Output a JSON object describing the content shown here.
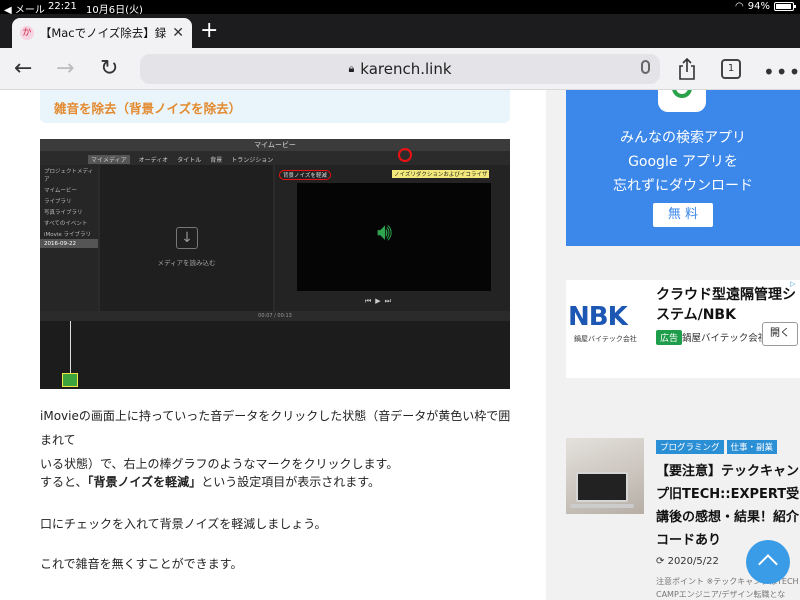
{
  "status_bar": {
    "left": "◀ メール",
    "time": "22:21",
    "date": "10月6日(火)",
    "battery": "94%",
    "battery_level": 0.94
  },
  "tab": {
    "title": "【Macでノイズ除去】録音した",
    "favicon": "か"
  },
  "toolbar": {
    "url": "karench.link",
    "tabs_count": "1"
  },
  "article": {
    "toc_text": "雑音を除去（背景ノイズを除去）",
    "screenshot": {
      "window_title": "マイムービー",
      "tabs": [
        "マイメディア",
        "オーディオ",
        "タイトル",
        "背景",
        "トランジション"
      ],
      "sidebar_items": [
        "プロジェクトメディア",
        "マイムービー",
        "ライブラリ",
        "写真ライブラリ",
        "すべてのイベント",
        "iMovie ライブラリ",
        "2016-09-22"
      ],
      "import_text": "メディアを読み込む",
      "noise_label": "背景ノイズを軽減",
      "eq_label": "ノイズリダクションおよびイコライザ",
      "timecode": "00:07 / 00:13"
    },
    "paragraphs": {
      "p1_line1": "iMovieの画面上に持っていった音データをクリックした状態（音データが黄色い枠で囲まれて",
      "p1_line2": "いる状態）で、右上の棒グラフのようなマークをクリックします。",
      "p2_before": "すると、",
      "p2_bold": "「背景ノイズを軽減」",
      "p2_after": "という設定項目が表示されます。",
      "p3": "口にチェックを入れて背景ノイズを軽減しましょう。",
      "p4": "これで雑音を無くすことができます。"
    }
  },
  "sidebar": {
    "ad_google": {
      "line1": "みんなの検索アプリ",
      "line2": "Google アプリを",
      "line3": "忘れずにダウンロード",
      "button": "無 料"
    },
    "ad_nbk": {
      "logo": "NBK",
      "logo_sub": "鍋屋バイテック会社",
      "headline": "クラウド型遠隔管理システム/NBK",
      "badge": "広告",
      "advertiser": "鍋屋バイテック会社",
      "open_button": "開く"
    },
    "related": {
      "categories": [
        "プログラミング",
        "仕事・副業"
      ],
      "title": "【要注意】テックキャンプ旧TECH::EXPERT受講後の感想・結果！紹介コードあり",
      "date": "2020/5/22",
      "excerpt": "注意ポイント ※テックキャンプはTECH CAMPエンジニア/デザイン転職となり…"
    }
  }
}
